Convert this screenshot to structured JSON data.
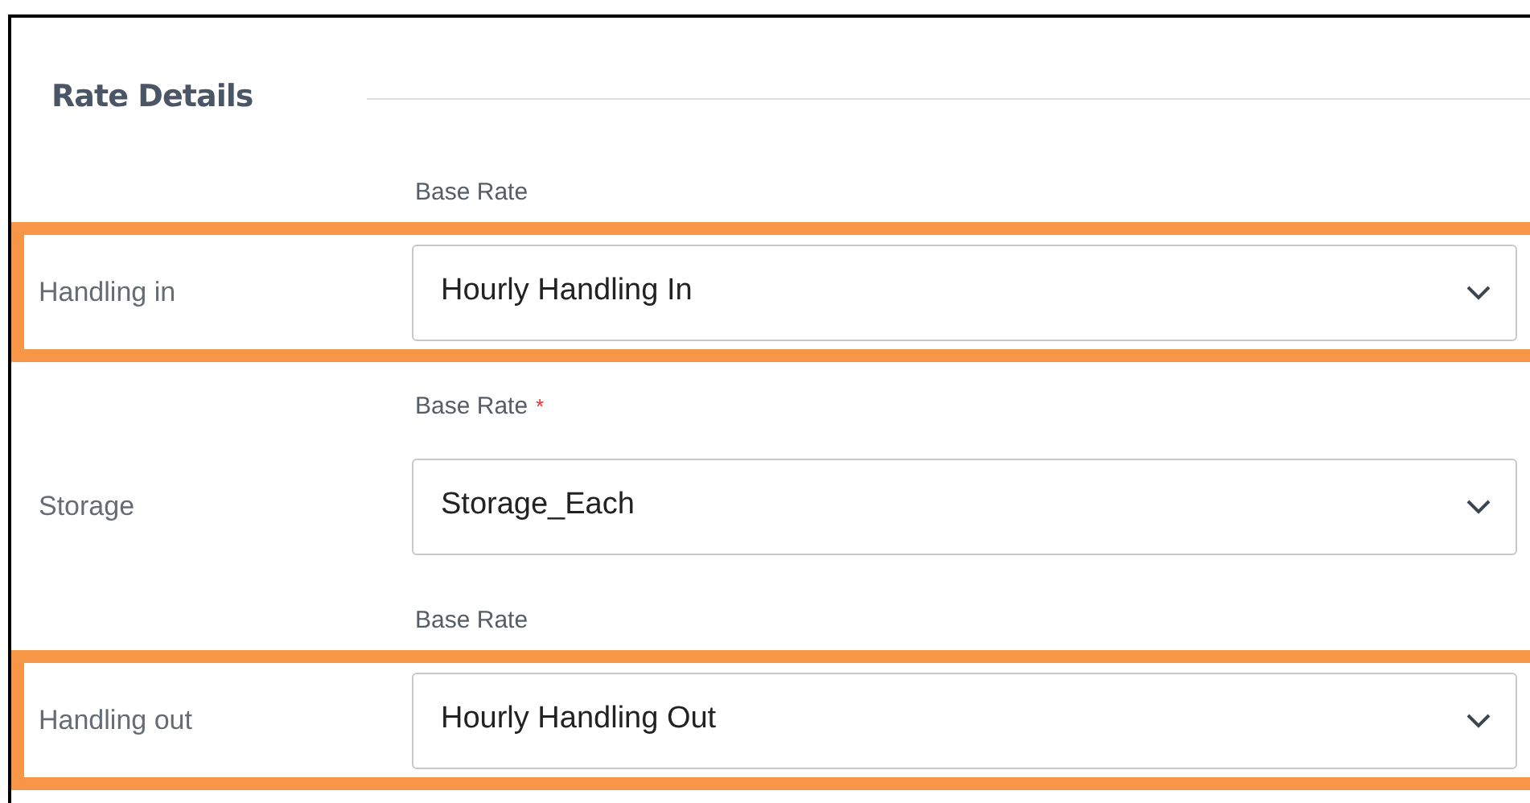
{
  "section": {
    "title": "Rate Details"
  },
  "rows": [
    {
      "label": "Handling in",
      "field_label": "Base Rate",
      "value": "Hourly Handling In",
      "highlighted": true
    },
    {
      "label": "Storage",
      "field_label": "Base Rate",
      "required_mark": "*",
      "value": "Storage_Each",
      "highlighted": false
    },
    {
      "label": "Handling out",
      "field_label": "Base Rate",
      "value": "Hourly Handling Out",
      "highlighted": true
    }
  ]
}
